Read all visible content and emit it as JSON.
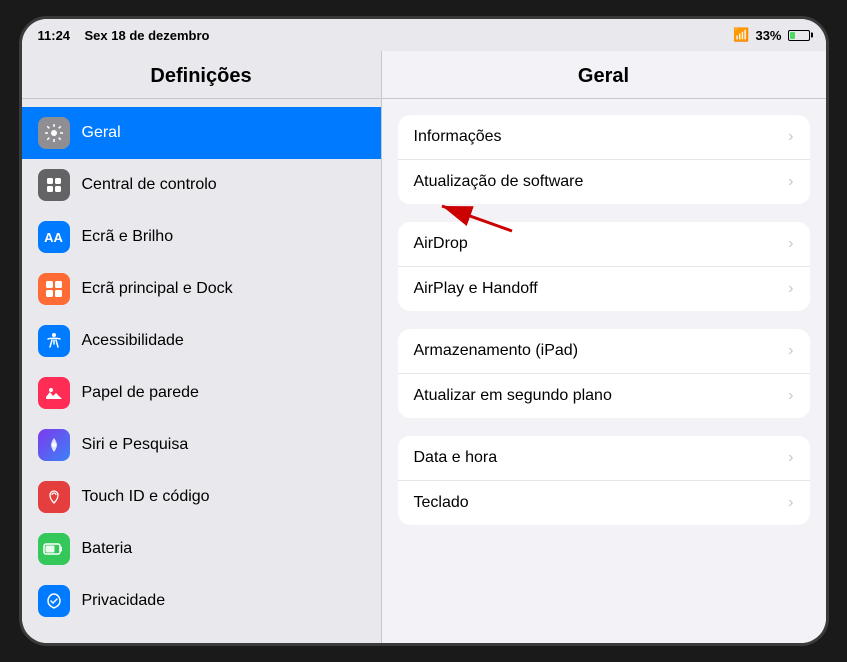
{
  "status_bar": {
    "time": "11:24",
    "date": "Sex 18 de dezembro",
    "wifi_signal": "wifi",
    "battery_percent": "33%"
  },
  "sidebar": {
    "title": "Definições",
    "items": [
      {
        "id": "geral",
        "label": "Geral",
        "icon": "⚙️",
        "icon_class": "icon-geral",
        "active": true
      },
      {
        "id": "central-controlo",
        "label": "Central de controlo",
        "icon": "⚙️",
        "icon_class": "icon-central",
        "active": false
      },
      {
        "id": "ecra-brilho",
        "label": "Ecrã e Brilho",
        "icon": "AA",
        "icon_class": "icon-ecra-brilho",
        "active": false
      },
      {
        "id": "ecra-dock",
        "label": "Ecrã principal e Dock",
        "icon": "⚙️",
        "icon_class": "icon-ecra-dock",
        "active": false
      },
      {
        "id": "acessibilidade",
        "label": "Acessibilidade",
        "icon": "♿",
        "icon_class": "icon-acessibilidade",
        "active": false
      },
      {
        "id": "papel-parede",
        "label": "Papel de parede",
        "icon": "🌸",
        "icon_class": "icon-papel",
        "active": false
      },
      {
        "id": "siri",
        "label": "Siri e Pesquisa",
        "icon": "🎙",
        "icon_class": "icon-siri",
        "active": false
      },
      {
        "id": "touch-id",
        "label": "Touch ID e código",
        "icon": "👆",
        "icon_class": "icon-touch",
        "active": false
      },
      {
        "id": "bateria",
        "label": "Bateria",
        "icon": "🔋",
        "icon_class": "icon-bateria",
        "active": false
      },
      {
        "id": "privacidade",
        "label": "Privacidade",
        "icon": "✋",
        "icon_class": "icon-privacidade",
        "active": false
      }
    ]
  },
  "main": {
    "title": "Geral",
    "groups": [
      {
        "id": "group1",
        "rows": [
          {
            "label": "Informações",
            "chevron": "›"
          },
          {
            "label": "Atualização de software",
            "chevron": "›"
          }
        ]
      },
      {
        "id": "group2",
        "rows": [
          {
            "label": "AirDrop",
            "chevron": "›"
          },
          {
            "label": "AirPlay e Handoff",
            "chevron": "›"
          }
        ]
      },
      {
        "id": "group3",
        "rows": [
          {
            "label": "Armazenamento (iPad)",
            "chevron": "›"
          },
          {
            "label": "Atualizar em segundo plano",
            "chevron": "›"
          }
        ]
      },
      {
        "id": "group4",
        "rows": [
          {
            "label": "Data e hora",
            "chevron": "›"
          },
          {
            "label": "Teclado",
            "chevron": "›"
          }
        ]
      }
    ]
  }
}
